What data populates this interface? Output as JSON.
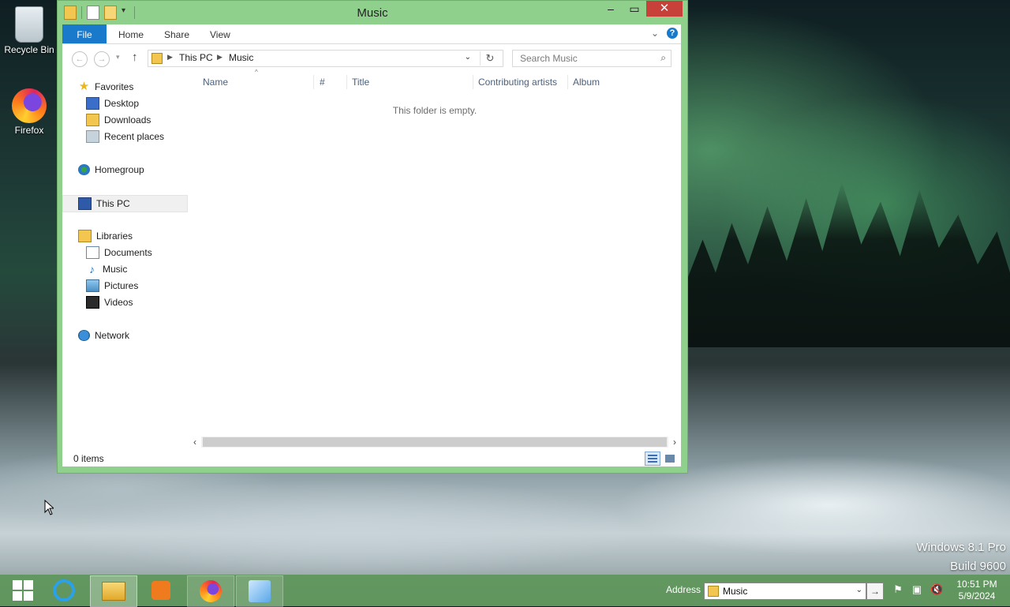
{
  "desktop": {
    "icons": [
      {
        "label": "Recycle Bin",
        "icon": "recycle-bin-icon"
      },
      {
        "label": "Firefox",
        "icon": "firefox-icon"
      }
    ],
    "watermark": {
      "line1": "Windows 8.1 Pro",
      "line2": "Build 9600"
    }
  },
  "window": {
    "title": "Music",
    "controls": {
      "minimize": "–",
      "maximize": "▭",
      "close": "✕"
    },
    "ribbon": {
      "tabs": [
        "File",
        "Home",
        "Share",
        "View"
      ]
    },
    "navigation": {
      "breadcrumb": [
        "This PC",
        "Music"
      ],
      "search_placeholder": "Search Music"
    },
    "nav_pane": {
      "favorites": {
        "label": "Favorites",
        "items": [
          "Desktop",
          "Downloads",
          "Recent places"
        ]
      },
      "homegroup": "Homegroup",
      "this_pc": "This PC",
      "libraries": {
        "label": "Libraries",
        "items": [
          "Documents",
          "Music",
          "Pictures",
          "Videos"
        ]
      },
      "network": "Network"
    },
    "columns": [
      "Name",
      "#",
      "Title",
      "Contributing artists",
      "Album"
    ],
    "empty_message": "This folder is empty.",
    "status": "0 items"
  },
  "taskbar": {
    "apps": [
      "start-button",
      "internet-explorer",
      "file-explorer",
      "media-player",
      "firefox",
      "app"
    ],
    "address_label": "Address",
    "address_value": "Music",
    "clock": {
      "time": "10:51 PM",
      "date": "5/9/2024"
    }
  },
  "colors": {
    "accent": "#1979ca",
    "window_frame": "#8fd08d",
    "taskbar": "#5e965a",
    "close": "#c7403a"
  }
}
